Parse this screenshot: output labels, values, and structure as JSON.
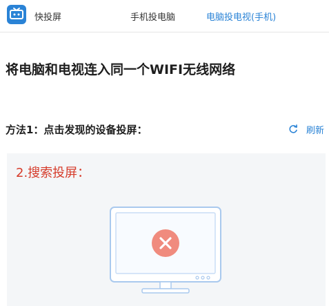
{
  "app": {
    "name": "快投屏"
  },
  "nav": {
    "tabs": [
      {
        "label": "手机投电脑",
        "active": false
      },
      {
        "label": "电脑投电视(手机)",
        "active": true
      }
    ]
  },
  "main": {
    "headline": "将电脑和电视连入同一个WIFI无线网络",
    "method_title": "方法1：点击发现的设备投屏：",
    "refresh_label": "刷新",
    "step_label": "2.搜索投屏："
  },
  "colors": {
    "accent": "#2a83d6",
    "step_label": "#d63b2a",
    "error": "#f08b7e",
    "panel_bg": "#f4f6f8"
  },
  "icons": {
    "logo": "tv-logo-icon",
    "refresh": "refresh-icon",
    "monitor": "monitor-icon",
    "error": "close-circle-icon"
  }
}
